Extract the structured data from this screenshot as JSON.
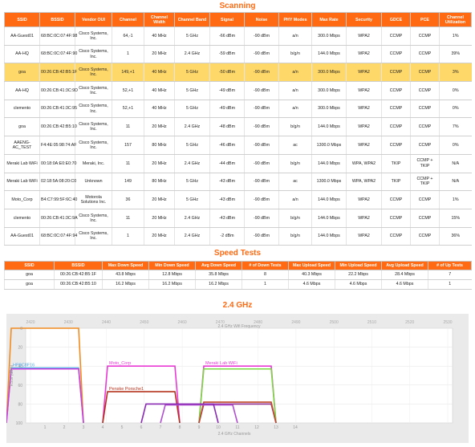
{
  "titles": {
    "scanning": "Scanning",
    "speed_tests": "Speed Tests",
    "ghz": "2.4 GHz"
  },
  "scan": {
    "headers": [
      "SSID",
      "BSSID",
      "Vendor OUI",
      "Channel",
      "Channel Width",
      "Channel Band",
      "Signal",
      "Noise",
      "PHY Modes",
      "Max Rate",
      "Security",
      "GDCE",
      "PCE",
      "Channel Utilization"
    ],
    "highlight_index": 2,
    "rows": [
      [
        "AA-Guest01",
        "68:BC:0C:07:4F:98",
        "Cisco Systems, Inc.",
        "64,-1",
        "40 MHz",
        "5 GHz",
        "-66 dBm",
        "-90 dBm",
        "a/n",
        "300.0 Mbps",
        "WPA2",
        "CCMP",
        "CCMP",
        "1%"
      ],
      [
        "AA-HQ",
        "68:BC:0C:07:4F:90",
        "Cisco Systems, Inc.",
        "1",
        "20 MHz",
        "2.4 GHz",
        "-59 dBm",
        "-90 dBm",
        "b/g/n",
        "144.0 Mbps",
        "WPA2",
        "CCMP",
        "CCMP",
        "39%"
      ],
      [
        "goa",
        "00:26:CB:42:B5:1F",
        "Cisco Systems, Inc.",
        "149,+1",
        "40 MHz",
        "5 GHz",
        "-50 dBm",
        "-90 dBm",
        "a/n",
        "300.0 Mbps",
        "WPA2",
        "CCMP",
        "CCMP",
        "3%"
      ],
      [
        "AA-HQ",
        "00:26:CB:41:3C:9D",
        "Cisco Systems, Inc.",
        "52,+1",
        "40 MHz",
        "5 GHz",
        "-49 dBm",
        "-90 dBm",
        "a/n",
        "300.0 Mbps",
        "WPA2",
        "CCMP",
        "CCMP",
        "0%"
      ],
      [
        "clemento",
        "00:26:CB:41:3C:95",
        "Cisco Systems, Inc.",
        "52,+1",
        "40 MHz",
        "5 GHz",
        "-49 dBm",
        "-90 dBm",
        "a/n",
        "300.0 Mbps",
        "WPA2",
        "CCMP",
        "CCMP",
        "0%"
      ],
      [
        "goa",
        "00:26:CB:42:B5:10",
        "Cisco Systems, Inc.",
        "11",
        "20 MHz",
        "2.4 GHz",
        "-48 dBm",
        "-90 dBm",
        "b/g/n",
        "144.0 Mbps",
        "WPA2",
        "CCMP",
        "CCMP",
        "7%"
      ],
      [
        "AAENG-AC_TEST",
        "F4:4E:05:98:74:AF",
        "Cisco Systems, Inc.",
        "157",
        "80 MHz",
        "5 GHz",
        "-46 dBm",
        "-90 dBm",
        "ac",
        "1300.0 Mbps",
        "WPA2",
        "CCMP",
        "CCMP",
        "0%"
      ],
      [
        "Meraki Lab WiFi",
        "00:18:0A:E0:E0:70",
        "Meraki, Inc.",
        "11",
        "20 MHz",
        "2.4 GHz",
        "-44 dBm",
        "-90 dBm",
        "b/g/n",
        "144.0 Mbps",
        "WPA, WPA2",
        "TKIP",
        "CCMP + TKIP",
        "N/A"
      ],
      [
        "Meraki Lab WiFi",
        "02:18:5A:08:20:C0",
        "Unknown",
        "149",
        "80 MHz",
        "5 GHz",
        "-43 dBm",
        "-90 dBm",
        "ac",
        "1300.0 Mbps",
        "WPA, WPA2",
        "TKIP",
        "CCMP + TKIP",
        "N/A"
      ],
      [
        "Moto_Corp",
        "B4:C7:99:5F:6C:40",
        "Motorola Solutions Inc.",
        "36",
        "20 MHz",
        "5 GHz",
        "-43 dBm",
        "-90 dBm",
        "a/n",
        "144.0 Mbps",
        "WPA2",
        "CCMP",
        "CCMP",
        "1%"
      ],
      [
        "clemento",
        "00:26:CB:41:3C:9A",
        "Cisco Systems, Inc.",
        "11",
        "20 MHz",
        "2.4 GHz",
        "-43 dBm",
        "-90 dBm",
        "b/g/n",
        "144.0 Mbps",
        "WPA2",
        "CCMP",
        "CCMP",
        "15%"
      ],
      [
        "AA-Guest01",
        "68:BC:0C:07:4F:94",
        "Cisco Systems, Inc.",
        "1",
        "20 MHz",
        "2.4 GHz",
        "-2 dBm",
        "-90 dBm",
        "b/g/n",
        "144.0 Mbps",
        "WPA2",
        "CCMP",
        "CCMP",
        "36%"
      ]
    ]
  },
  "speed": {
    "headers": [
      "SSID",
      "BSSID",
      "Max Down Speed",
      "Min Down Speed",
      "Avg Down Speed",
      "# of Down Tests",
      "Max Upload Speed",
      "Min Upload Speed",
      "Avg Upload Speed",
      "# of Up Tests"
    ],
    "rows": [
      [
        "goa",
        "00:26:CB:42:B5:1F",
        "43.8 Mbps",
        "12.8 Mbps",
        "35.8 Mbps",
        "8",
        "40.3 Mbps",
        "22.2 Mbps",
        "28.4 Mbps",
        "7"
      ],
      [
        "goa",
        "00:26:CB:42:B5:10",
        "16.2 Mbps",
        "16.2 Mbps",
        "16.2 Mbps",
        "1",
        "4.6 Mbps",
        "4.6 Mbps",
        "4.6 Mbps",
        "1"
      ]
    ]
  },
  "chart_data": {
    "type": "area",
    "title": "2.4 GHz",
    "top_axis_label": "2.4 GHz Wifi Frequency",
    "top_ticks": [
      2420,
      2430,
      2440,
      2450,
      2460,
      2470,
      2480,
      2490,
      2500,
      2510,
      2520,
      2530
    ],
    "xlabel": "2.4 GHz Channels",
    "x_ticks": [
      1,
      2,
      3,
      4,
      5,
      6,
      7,
      8,
      9,
      10,
      11,
      12,
      13,
      14
    ],
    "ylabel": "RSSI (dBm)",
    "y_ticks": [
      0,
      20,
      40,
      60,
      80,
      100
    ],
    "ylim": [
      0,
      100
    ],
    "series": [
      {
        "name": "",
        "channel": 1,
        "rssi": 0,
        "color": "#f28b1f"
      },
      {
        "name": "HP8C8F16",
        "channel": 1,
        "rssi": 42,
        "color": "#4fa8e8"
      },
      {
        "name": "",
        "channel": 1,
        "rssi": 43,
        "color": "#cc3fd9"
      },
      {
        "name": "Moto_Corp",
        "channel": 6,
        "rssi": 40,
        "color": "#e93ad6"
      },
      {
        "name": "Penske Porsche1",
        "channel": 6,
        "rssi": 67,
        "color": "#b4321c"
      },
      {
        "name": "Meraki Lab WiFi",
        "channel": 11,
        "rssi": 40,
        "color": "#e93ad6"
      },
      {
        "name": "",
        "channel": 11,
        "rssi": 43,
        "color": "#79d83f"
      },
      {
        "name": "",
        "channel": 11,
        "rssi": 80,
        "color": "#8f2b8f"
      },
      {
        "name": "",
        "channel": 11,
        "rssi": 78,
        "color": "#c04a29"
      },
      {
        "name": "",
        "channel": 9,
        "rssi": 81,
        "color": "#b24fd0"
      },
      {
        "name": "",
        "channel": 8,
        "rssi": 80,
        "color": "#8a2bb3"
      }
    ]
  }
}
